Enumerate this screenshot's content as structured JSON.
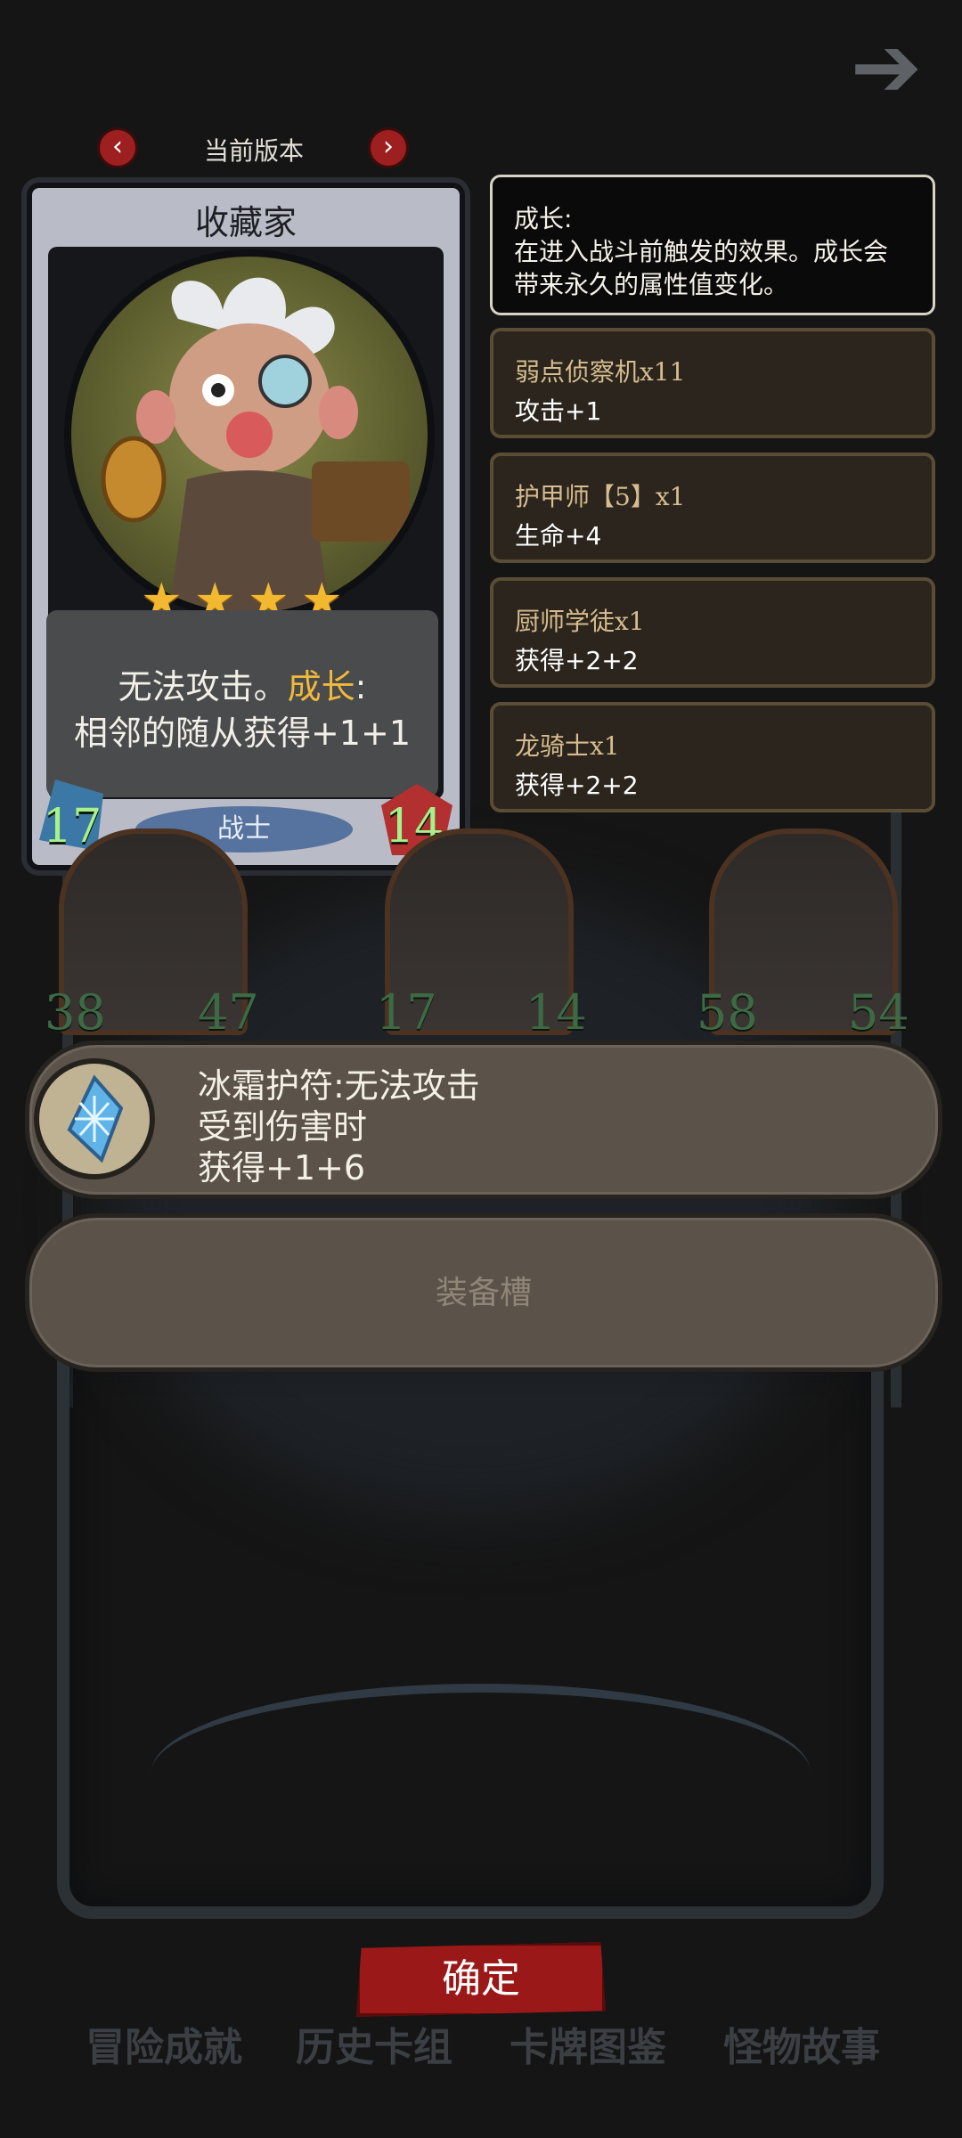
{
  "nav": {
    "back_icon": "back-arrow-icon",
    "version_label": "当前版本",
    "prev_icon": "chevron-left-icon",
    "next_icon": "chevron-right-icon",
    "prev_glyph": "‹",
    "next_glyph": "›"
  },
  "card": {
    "name": "收藏家",
    "stars": 4,
    "desc_line1_a": "无法攻击。",
    "desc_keyword": "成长",
    "desc_line1_b": ":",
    "desc_line2": "相邻的随从获得+1+1",
    "attack": "17",
    "health": "14",
    "tribe": "战士"
  },
  "info": {
    "title": "成长:",
    "body": "在进入战斗前触发的效果。成长会带来永久的属性值变化。"
  },
  "skills": [
    {
      "name": "弱点侦察机x11",
      "effect": "攻击+1"
    },
    {
      "name": "护甲师【5】x1",
      "effect": "生命+4"
    },
    {
      "name": "厨师学徒x1",
      "effect": "获得+2+2"
    },
    {
      "name": "龙骑士x1",
      "effect": "获得+2+2"
    }
  ],
  "board": {
    "minions": [
      {
        "attack": "38",
        "health": "47"
      },
      {
        "attack": "17",
        "health": "14"
      },
      {
        "attack": "58",
        "health": "54"
      }
    ]
  },
  "trinket": {
    "icon": "frost-charm-icon",
    "line1": "冰霜护符:无法攻击",
    "line2": "受到伤害时",
    "line3": "获得+1+6"
  },
  "equip_slot": {
    "label": "装备槽"
  },
  "confirm": {
    "label": "确定"
  },
  "tabs": [
    "冒险成就",
    "历史卡组",
    "卡牌图鉴",
    "怪物故事"
  ],
  "colors": {
    "accent_red": "#9b1818",
    "keyword_gold": "#f0b93c",
    "star_gold": "#f2b830",
    "stat_green": "#a7f08a"
  }
}
